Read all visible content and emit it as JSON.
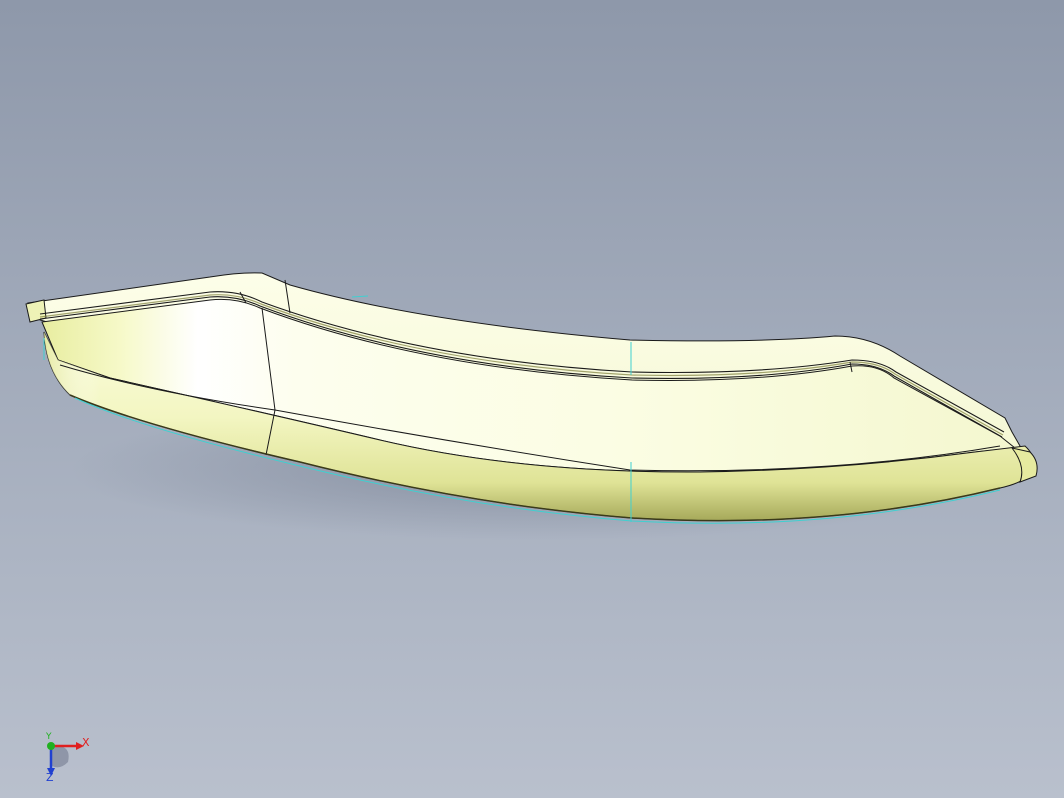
{
  "viewport": {
    "background_top": "#8e98aa",
    "background_bottom": "#b9c0cd"
  },
  "model": {
    "face_color": "#fbfde0",
    "highlight_color": "#ffffff",
    "shade_color": "#d9dd8f",
    "edge_color": "#1a1a1a",
    "sketch_line_color": "#3fd0d0"
  },
  "triad": {
    "x_label": "X",
    "y_label": "Y",
    "z_label": "Z",
    "x_color": "#e02020",
    "y_color": "#20b020",
    "z_color": "#2040d0"
  }
}
